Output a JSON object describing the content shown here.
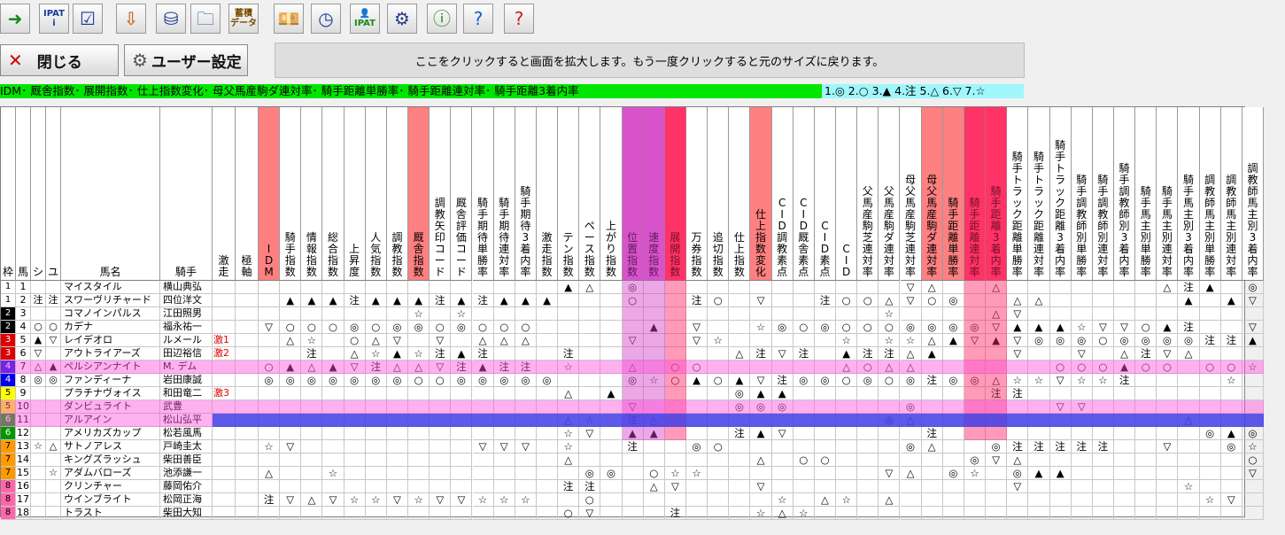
{
  "toolbar": {
    "icons": [
      {
        "name": "exit-icon",
        "glyph": "➜",
        "color": "#1a8a1a"
      },
      {
        "name": "ipat-info-icon",
        "glyph": "IPAT\ni",
        "color": "#1a3a9a",
        "text": true
      },
      {
        "name": "checklist-icon",
        "glyph": "☑",
        "color": "#1a3a9a"
      },
      {
        "name": "download-icon",
        "glyph": "⇩",
        "color": "#c05000"
      },
      {
        "name": "database-download-icon",
        "glyph": "⛁",
        "color": "#1a3a9a"
      },
      {
        "name": "open-folder-icon",
        "glyph": "🗀",
        "color": "#1a5aa0"
      },
      {
        "name": "accumulated-data-icon",
        "glyph": "蓄積\nデータ",
        "color": "#7a4a00",
        "text": true
      },
      {
        "name": "money-icon",
        "glyph": "💴",
        "color": "#1a6a2a"
      },
      {
        "name": "clock-icon",
        "glyph": "◷",
        "color": "#1a3a9a"
      },
      {
        "name": "ipat-user-icon",
        "glyph": "👤\nIPAT",
        "color": "#1a8a1a",
        "text": true
      },
      {
        "name": "gear-icon",
        "glyph": "⚙",
        "color": "#2a3a8a"
      },
      {
        "name": "info-icon",
        "glyph": "ⓘ",
        "color": "#1a8a1a"
      },
      {
        "name": "help-icon",
        "glyph": "?",
        "color": "#1a5ad0"
      },
      {
        "name": "help-red-icon",
        "glyph": "?",
        "color": "#d01a2a"
      }
    ]
  },
  "close_label": "閉じる",
  "user_settings_label": "ユーザー設定",
  "banner_text": "ここをクリックすると画面を拡大します。もう一度クリックすると元のサイズに戻ります。",
  "legend_text": "IDM･ 厩舎指数･ 展開指数･ 仕上指数変化･ 母父馬産駒ダ連対率･ 騎手距離単勝率･ 騎手距離連対率･ 騎手距離3着内率",
  "legend_symbols": "1.◎ 2.○ 3.▲ 4.注 5.△ 6.▽ 7.☆",
  "columns": [
    "枠",
    "馬",
    "シ",
    "ユ",
    "馬名",
    "騎手",
    "激走",
    "極軸",
    "IDM",
    "騎手指数",
    "情報指数",
    "総合指数",
    "上昇度",
    "人気指数",
    "調教指数",
    "厩舎指数",
    "調教矢印コード",
    "厩舎評価コード",
    "騎手期待単勝率",
    "騎手期待連対率",
    "騎手期待3着内率",
    "激走指数",
    "テン指数",
    "ペース指数",
    "上がり指数",
    "位置指数",
    "速度指数",
    "展開指数",
    "万券指数",
    "追切指数",
    "仕上指数",
    "仕上指数変化",
    "CID調教素点",
    "CID厩舎素点",
    "CID素点",
    "CID",
    "父馬産駒芝連対率",
    "父馬産駒ダ連対率",
    "母父馬産駒芝連対率",
    "母父馬産駒ダ連対率",
    "騎手距離単勝率",
    "騎手距離連対率",
    "騎手距離3着内率",
    "騎手トラック距離単勝率",
    "騎手トラック距離連対率",
    "騎手トラック距離3着内率",
    "騎手調教師別単勝率",
    "騎手調教師別連対率",
    "騎手調教師別3着内率",
    "騎手馬主別単勝率",
    "騎手馬主別連対率",
    "騎手馬主別3着内率",
    "調教師馬主別単勝率",
    "調教師馬主別連対率",
    "調教師馬主別3着内率"
  ],
  "rows": [
    {
      "waku": "1",
      "uma": "1",
      "shi": "",
      "yu": "",
      "name": "マイスタイル",
      "jockey": "横山典弘",
      "geki": "",
      "m": [
        "",
        "",
        "",
        "",
        "",
        "",
        "",
        "",
        "",
        "",
        "",
        "",
        "",
        "",
        "▲",
        "△",
        "",
        "◎",
        "",
        "",
        "",
        "",
        "",
        "",
        "",
        "",
        "",
        "",
        "",
        "",
        "▽",
        "△",
        "",
        "",
        "△",
        "",
        "",
        "",
        "",
        "",
        "",
        "",
        "△",
        "注",
        "▲",
        "",
        "◎",
        "◎",
        "▲",
        "注",
        "▽"
      ]
    },
    {
      "waku": "1",
      "uma": "2",
      "shi": "注",
      "yu": "注",
      "name": "スワーヴリチャード",
      "jockey": "四位洋文",
      "geki": "",
      "m": [
        "",
        "▲",
        "▲",
        "▲",
        "注",
        "▲",
        "▲",
        "▲",
        "注",
        "▲",
        "注",
        "▲",
        "▲",
        "▲",
        "",
        "",
        "",
        "○",
        "",
        "",
        "注",
        "○",
        "",
        "▽",
        "",
        "",
        "注",
        "○",
        "○",
        "△",
        "▽",
        "○",
        "◎",
        "",
        "",
        "△",
        "△",
        "",
        "",
        "",
        "",
        "",
        "",
        "▲",
        "",
        "▲",
        "▽",
        "注",
        "☆",
        "注"
      ]
    },
    {
      "waku": "2",
      "uma": "3",
      "shi": "",
      "yu": "",
      "name": "コマノインパルス",
      "jockey": "江田照男",
      "geki": "",
      "m": [
        "",
        "",
        "",
        "",
        "",
        "",
        "",
        "☆",
        "",
        "☆",
        "",
        "",
        "",
        "",
        "",
        "",
        "",
        "",
        "",
        "",
        "",
        "",
        "",
        "",
        "",
        "",
        "",
        "",
        "",
        "☆",
        "",
        "",
        "",
        "",
        "△",
        "▽",
        "",
        "",
        "",
        "",
        "",
        "",
        "",
        "",
        "",
        "",
        "",
        "",
        "注",
        ""
      ]
    },
    {
      "waku": "2",
      "uma": "4",
      "shi": "○",
      "yu": "○",
      "name": "カデナ",
      "jockey": "福永祐一",
      "geki": "",
      "m": [
        "▽",
        "○",
        "○",
        "○",
        "◎",
        "○",
        "◎",
        "◎",
        "○",
        "◎",
        "○",
        "○",
        "○",
        "",
        "",
        "",
        "",
        "",
        "▲",
        "",
        "▽",
        "",
        "",
        "☆",
        "◎",
        "○",
        "◎",
        "○",
        "○",
        "○",
        "◎",
        "◎",
        "◎",
        "◎",
        "▽",
        "▲",
        "▲",
        "▲",
        "☆",
        "▽",
        "▽",
        "○",
        "▲",
        "注",
        "",
        "",
        "▽",
        "",
        ""
      ]
    },
    {
      "waku": "3",
      "uma": "5",
      "shi": "▲",
      "yu": "▽",
      "name": "レイデオロ",
      "jockey": "ルメール",
      "geki": "激1",
      "m": [
        "",
        "△",
        "☆",
        "",
        "○",
        "△",
        "▽",
        "",
        "▽",
        "",
        "△",
        "△",
        "△",
        "",
        "",
        "",
        "",
        "▽",
        "",
        "",
        "▽",
        "☆",
        "",
        "",
        "",
        "",
        "",
        "☆",
        "",
        "☆",
        "☆",
        "△",
        "▲",
        "▽",
        "▲",
        "▽",
        "◎",
        "◎",
        "◎",
        "○",
        "◎",
        "◎",
        "◎",
        "◎",
        "注",
        "注",
        "▲",
        "○",
        "▲",
        "▲"
      ]
    },
    {
      "waku": "3",
      "uma": "6",
      "shi": "▽",
      "yu": "",
      "name": "アウトライアーズ",
      "jockey": "田辺裕信",
      "geki": "激2",
      "m": [
        "",
        "",
        "注",
        "",
        "△",
        "☆",
        "▲",
        "☆",
        "注",
        "▲",
        "注",
        "",
        "",
        "",
        "注",
        "",
        "",
        "",
        "",
        "",
        "",
        "",
        "△",
        "注",
        "▽",
        "注",
        "",
        "▲",
        "注",
        "注",
        "△",
        "▲",
        "",
        "",
        "",
        "▽",
        "",
        "",
        "▽",
        "",
        "△",
        "注",
        "▽",
        "△",
        "",
        "",
        "",
        "",
        "",
        ""
      ]
    },
    {
      "waku": "4",
      "uma": "7",
      "shi": "△",
      "yu": "▲",
      "name": "ペルシアンナイト",
      "jockey": "M. デム",
      "geki": "",
      "m": [
        "○",
        "▲",
        "△",
        "▲",
        "▽",
        "注",
        "△",
        "△",
        "▽",
        "注",
        "▲",
        "注",
        "注",
        "",
        "☆",
        "",
        "",
        "△",
        "",
        "○",
        "○",
        "",
        "",
        "",
        "",
        "",
        "",
        "△",
        "○",
        "△",
        "△",
        "",
        "",
        "",
        "",
        "",
        "",
        "○",
        "○",
        "○",
        "▲",
        "○",
        "○",
        "",
        "○",
        "○",
        "☆",
        "○",
        "○",
        ""
      ]
    },
    {
      "waku": "4",
      "uma": "8",
      "shi": "◎",
      "yu": "◎",
      "name": "ファンディーナ",
      "jockey": "岩田康誠",
      "geki": "",
      "m": [
        "◎",
        "◎",
        "◎",
        "◎",
        "◎",
        "◎",
        "◎",
        "○",
        "○",
        "◎",
        "◎",
        "◎",
        "◎",
        "◎",
        "",
        "",
        "",
        "◎",
        "☆",
        "○",
        "▲",
        "○",
        "▲",
        "▽",
        "注",
        "◎",
        "◎",
        "○",
        "◎",
        "○",
        "◎",
        "注",
        "◎",
        "◎",
        "△",
        "☆",
        "☆",
        "▽",
        "☆",
        "☆",
        "注",
        "",
        "",
        "",
        "",
        "☆",
        "",
        "",
        "",
        ""
      ]
    },
    {
      "waku": "5",
      "uma": "9",
      "shi": "",
      "yu": "",
      "name": "プラチナヴォイス",
      "jockey": "和田竜二",
      "geki": "激3",
      "m": [
        "",
        "",
        "",
        "",
        "",
        "",
        "",
        "",
        "",
        "",
        "",
        "",
        "",
        "",
        "△",
        "",
        "▲",
        "",
        "",
        "",
        "",
        "",
        "◎",
        "▲",
        "▲",
        "",
        "",
        "",
        "",
        "",
        "",
        "",
        "",
        "",
        "注",
        "注",
        "",
        "",
        "",
        "",
        "",
        "",
        "",
        "",
        "",
        "",
        "",
        "",
        "",
        ""
      ]
    },
    {
      "waku": "5",
      "uma": "10",
      "shi": "",
      "yu": "",
      "name": "ダンビュライト",
      "jockey": "武豊",
      "geki": "",
      "m": [
        "",
        "",
        "",
        "",
        "",
        "",
        "",
        "",
        "",
        "",
        "",
        "",
        "",
        "",
        "",
        "",
        "",
        "▽",
        "",
        "",
        "",
        "",
        "◎",
        "◎",
        "◎",
        "",
        "",
        "",
        "",
        "",
        "◎",
        "",
        "",
        "",
        "",
        "",
        "",
        "▽",
        "▽",
        "",
        "",
        "",
        "",
        "",
        "",
        "",
        "",
        "",
        "",
        ""
      ]
    },
    {
      "waku": "6",
      "uma": "11",
      "shi": "",
      "yu": "",
      "name": "アルアイン",
      "jockey": "松山弘平",
      "geki": "",
      "m": [
        "",
        "",
        "",
        "",
        "",
        "",
        "",
        "",
        "",
        "",
        "",
        "",
        "",
        "",
        "△",
        "☆",
        "",
        "注",
        "△",
        "",
        "",
        "",
        "",
        "",
        "",
        "",
        "",
        "",
        "",
        "◎",
        "△",
        "",
        "",
        "",
        "",
        "",
        "",
        "",
        "",
        "",
        "",
        "",
        "",
        "△",
        "",
        "",
        "",
        "▽",
        "☆",
        "△"
      ]
    },
    {
      "waku": "6",
      "uma": "12",
      "shi": "",
      "yu": "",
      "name": "アメリカズカップ",
      "jockey": "松若風馬",
      "geki": "",
      "m": [
        "",
        "",
        "",
        "",
        "",
        "",
        "",
        "",
        "",
        "",
        "",
        "",
        "",
        "",
        "☆",
        "▽",
        "",
        "▲",
        "▲",
        "",
        "",
        "",
        "注",
        "▲",
        "▽",
        "",
        "",
        "",
        "",
        "",
        "",
        "注",
        "",
        "",
        "",
        "",
        "",
        "",
        "",
        "",
        "",
        "",
        "",
        "",
        "◎",
        "▲",
        "◎",
        "△",
        "◎",
        ""
      ]
    },
    {
      "waku": "7",
      "uma": "13",
      "shi": "☆",
      "yu": "△",
      "name": "サトノアレス",
      "jockey": "戸崎圭太",
      "geki": "",
      "m": [
        "☆",
        "▽",
        "",
        "",
        "",
        "",
        "",
        "",
        "",
        "",
        "▽",
        "▽",
        "▽",
        "",
        "☆",
        "",
        "",
        "注",
        "",
        "",
        "◎",
        "○",
        "",
        "",
        "",
        "",
        "",
        "",
        "",
        "",
        "◎",
        "△",
        "",
        "",
        "◎",
        "注",
        "注",
        "注",
        "注",
        "注",
        "",
        "",
        "▽",
        "",
        "",
        "◎",
        "☆",
        ""
      ]
    },
    {
      "waku": "7",
      "uma": "14",
      "shi": "",
      "yu": "",
      "name": "キングズラッシュ",
      "jockey": "柴田善臣",
      "geki": "",
      "m": [
        "",
        "",
        "",
        "",
        "",
        "",
        "",
        "",
        "",
        "",
        "",
        "",
        "",
        "",
        "△",
        "",
        "",
        "",
        "",
        "",
        "",
        "",
        "",
        "△",
        "",
        "○",
        "○",
        "",
        "",
        "",
        "",
        "",
        "",
        "◎",
        "▽",
        "△",
        "",
        "",
        "",
        "",
        "",
        "",
        "",
        "",
        "",
        "",
        "○",
        "△",
        "☆",
        "▽",
        "○",
        "☆"
      ]
    },
    {
      "waku": "7",
      "uma": "15",
      "shi": "",
      "yu": "☆",
      "name": "アダムバローズ",
      "jockey": "池添謙一",
      "geki": "",
      "m": [
        "△",
        "",
        "",
        "☆",
        "",
        "",
        "",
        "",
        "",
        "",
        "",
        "",
        "",
        "",
        "",
        "◎",
        "◎",
        "",
        "○",
        "☆",
        "☆",
        "",
        "",
        "",
        "",
        "",
        "",
        "",
        "",
        "▽",
        "△",
        "",
        "◎",
        "☆",
        "",
        "◎",
        "▲",
        "▲",
        "",
        "",
        "",
        "",
        "",
        "",
        "",
        "",
        "▽",
        "▽",
        "☆",
        "△"
      ]
    },
    {
      "waku": "8",
      "uma": "16",
      "shi": "",
      "yu": "",
      "name": "クリンチャー",
      "jockey": "藤岡佑介",
      "geki": "",
      "m": [
        "",
        "",
        "",
        "",
        "",
        "",
        "",
        "",
        "",
        "",
        "",
        "",
        "",
        "",
        "注",
        "注",
        "",
        "",
        "△",
        "▽",
        "",
        "",
        "",
        "▽",
        "",
        "",
        "",
        "",
        "",
        "",
        "",
        "",
        "",
        "",
        "",
        "▽",
        "",
        "",
        "",
        "",
        "",
        "",
        "",
        "☆",
        "",
        "",
        "",
        "",
        "",
        ""
      ]
    },
    {
      "waku": "8",
      "uma": "17",
      "shi": "",
      "yu": "",
      "name": "ウインブライト",
      "jockey": "松岡正海",
      "geki": "",
      "m": [
        "注",
        "▽",
        "△",
        "▽",
        "☆",
        "☆",
        "▽",
        "☆",
        "▽",
        "▽",
        "☆",
        "☆",
        "☆",
        "",
        "",
        "○",
        "",
        "",
        "",
        "",
        "",
        "",
        "",
        "",
        "☆",
        "",
        "△",
        "☆",
        "",
        "△",
        "",
        "",
        "",
        "",
        "",
        "",
        "",
        "",
        "",
        "",
        "",
        "",
        "",
        "",
        "☆",
        "▽",
        "",
        "",
        "",
        ""
      ]
    },
    {
      "waku": "8",
      "uma": "18",
      "shi": "",
      "yu": "",
      "name": "トラスト",
      "jockey": "柴田大知",
      "geki": "",
      "m": [
        "",
        "",
        "",
        "",
        "",
        "",
        "",
        "",
        "",
        "",
        "",
        "",
        "",
        "",
        "○",
        "▽",
        "",
        "",
        "",
        "注",
        "",
        "",
        "",
        "☆",
        "△",
        "☆",
        "",
        "",
        "",
        "",
        "",
        "",
        "",
        "",
        "",
        "",
        "",
        "",
        "",
        "",
        "",
        "",
        "",
        "",
        "",
        "",
        "",
        "",
        "",
        ""
      ]
    }
  ],
  "colors": {
    "waku": [
      "#ffffff",
      "#ffffff",
      "#000000",
      "#000000",
      "#ff0000",
      "#ff0000",
      "#0000ff",
      "#0000ff",
      "#ffff00",
      "#ffff00",
      "#008000",
      "#008000",
      "#ff8c00",
      "#ff8c00",
      "#ff8c00",
      "#ff69b4",
      "#ff69b4",
      "#ff69b4"
    ]
  }
}
